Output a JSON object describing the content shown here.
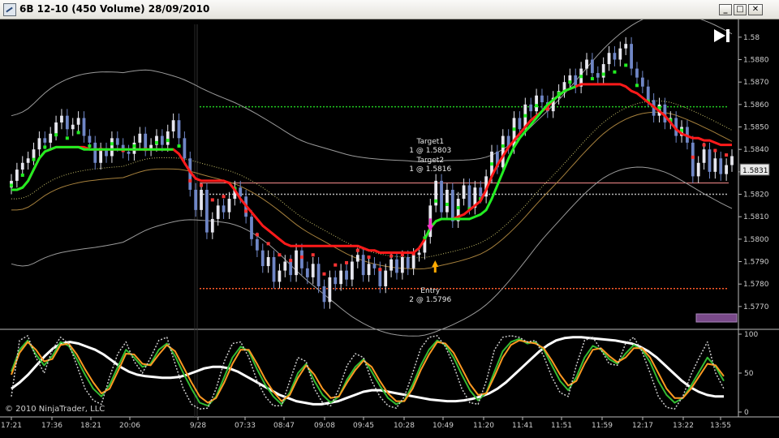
{
  "window": {
    "title": "6B 12-10 (450 Volume)  28/09/2010",
    "minimize_label": "_",
    "maximize_label": "□",
    "close_label": "✕"
  },
  "copyright": "© 2010 NinjaTrader, LLC",
  "colors": {
    "background": "#000000",
    "up_bar": "#e6e6ee",
    "down_bar": "#6f86c6",
    "slow_ma": "#ff1a1a",
    "fast_ma": "#22ee22",
    "dots_up": "#22ee22",
    "dots_down": "#ff3333",
    "target_line": "#20cc20",
    "stop_line": "#ff5a2a",
    "entry_line": "#ff9090",
    "osc_white": "#ffffff",
    "osc_green": "#33bb33",
    "osc_orange": "#ff9922",
    "osc_dotted": "#cccccc"
  },
  "chart_data": [
    {
      "type": "candlestick",
      "ylim": [
        1.5762,
        1.5895
      ],
      "y_ticks": [
        "1.5770",
        "1.5780",
        "1.5790",
        "1.5800",
        "1.5810",
        "1.5820",
        "1.5830",
        "1.5840",
        "1.5850",
        "1.5860",
        "1.5870",
        "1.5880",
        "1.58"
      ],
      "last_price": "1.5831",
      "x_labels": [
        "17:21",
        "17:36",
        "18:21",
        "20:06",
        "9/28",
        "07:33",
        "08:47",
        "09:08",
        "09:45",
        "10:28",
        "10:49",
        "11:20",
        "11:41",
        "11:51",
        "11:59",
        "12:17",
        "13:22",
        "13:55"
      ],
      "levels": {
        "target": 1.5859,
        "target_line2": 1.582,
        "entry": 1.5825,
        "stop": 1.5778
      },
      "annotations": [
        {
          "lines": [
            "Target1",
            "1 @ 1.5803"
          ]
        },
        {
          "lines": [
            "Target2",
            "1 @ 1.5816"
          ]
        },
        {
          "lines": [
            "Entry",
            "2 @ 1.5796"
          ]
        }
      ],
      "close": [
        1.5826,
        1.5831,
        1.5834,
        1.5836,
        1.584,
        1.5845,
        1.5843,
        1.5847,
        1.5852,
        1.5855,
        1.5849,
        1.5851,
        1.5854,
        1.5846,
        1.5843,
        1.5834,
        1.584,
        1.5837,
        1.5845,
        1.5842,
        1.5839,
        1.5838,
        1.5843,
        1.5847,
        1.584,
        1.5842,
        1.5846,
        1.5842,
        1.5848,
        1.5853,
        1.5845,
        1.5836,
        1.5822,
        1.5813,
        1.5822,
        1.5803,
        1.5809,
        1.5815,
        1.5812,
        1.5818,
        1.5823,
        1.5819,
        1.581,
        1.58,
        1.5795,
        1.5788,
        1.5792,
        1.5781,
        1.5786,
        1.579,
        1.5784,
        1.5795,
        1.5787,
        1.5783,
        1.5789,
        1.5779,
        1.5772,
        1.5783,
        1.578,
        1.5786,
        1.5782,
        1.579,
        1.5793,
        1.5784,
        1.5789,
        1.5787,
        1.5779,
        1.5786,
        1.5791,
        1.5785,
        1.5792,
        1.5787,
        1.5793,
        1.5794,
        1.5801,
        1.5815,
        1.5826,
        1.5812,
        1.5822,
        1.5808,
        1.5818,
        1.5824,
        1.5814,
        1.5823,
        1.5819,
        1.5828,
        1.5839,
        1.5832,
        1.5846,
        1.5841,
        1.5854,
        1.5849,
        1.586,
        1.5857,
        1.5864,
        1.5861,
        1.5857,
        1.5863,
        1.5866,
        1.587,
        1.5873,
        1.5868,
        1.5876,
        1.588,
        1.5874,
        1.5872,
        1.5878,
        1.5883,
        1.588,
        1.5885,
        1.5887,
        1.5876,
        1.5872,
        1.5868,
        1.5862,
        1.5855,
        1.586,
        1.5852,
        1.5854,
        1.5846,
        1.585,
        1.5843,
        1.5828,
        1.5834,
        1.584,
        1.583,
        1.5836,
        1.5829,
        1.5833,
        1.5837
      ],
      "slow_ma": [
        1.5822,
        1.5822,
        1.5823,
        1.5826,
        1.5831,
        1.5836,
        1.5839,
        1.584,
        1.5841,
        1.5841,
        1.5841,
        1.5841,
        1.5841,
        1.5841,
        1.584,
        1.584,
        1.584,
        1.584,
        1.584,
        1.584,
        1.584,
        1.584,
        1.584,
        1.584,
        1.584,
        1.584,
        1.584,
        1.584,
        1.584,
        1.584,
        1.5838,
        1.5834,
        1.583,
        1.5827,
        1.5826,
        1.5826,
        1.5826,
        1.5826,
        1.5826,
        1.5825,
        1.5822,
        1.5818,
        1.5815,
        1.5812,
        1.5809,
        1.5806,
        1.5804,
        1.5802,
        1.58,
        1.5798,
        1.5797,
        1.5797,
        1.5797,
        1.5797,
        1.5797,
        1.5797,
        1.5797,
        1.5797,
        1.5797,
        1.5797,
        1.5797,
        1.5797,
        1.5797,
        1.5796,
        1.5795,
        1.5795,
        1.5794,
        1.5794,
        1.5794,
        1.5794,
        1.5794,
        1.5794,
        1.5794,
        1.5796,
        1.58,
        1.5805,
        1.5808,
        1.5809,
        1.5809,
        1.5809,
        1.581,
        1.5811,
        1.5813,
        1.5815,
        1.5817,
        1.5822,
        1.5828,
        1.5833,
        1.5837,
        1.5841,
        1.5844,
        1.5847,
        1.585,
        1.5853,
        1.5855,
        1.5857,
        1.5859,
        1.5862,
        1.5864,
        1.5866,
        1.5867,
        1.5868,
        1.5869,
        1.5869,
        1.5869,
        1.5869,
        1.5869,
        1.5869,
        1.5869,
        1.5869,
        1.5868,
        1.5866,
        1.5865,
        1.5863,
        1.5861,
        1.5859,
        1.5857,
        1.5855,
        1.5852,
        1.5849,
        1.5847,
        1.5846,
        1.5845,
        1.5845,
        1.5844,
        1.5844,
        1.5843,
        1.5842,
        1.5842,
        1.5842
      ],
      "fast_ma": [
        1.5822,
        1.5822,
        1.5823,
        1.5826,
        1.5831,
        1.5836,
        1.5839,
        1.584,
        1.5841,
        1.5841,
        1.5841,
        1.5841,
        1.5841,
        1.584,
        1.584,
        1.584,
        1.584,
        1.584,
        1.584,
        1.584,
        1.584,
        1.584,
        1.584,
        1.584,
        1.584,
        1.584,
        1.584,
        1.584,
        1.584,
        1.584,
        1.5838,
        1.5834,
        1.583,
        1.5827,
        1.5826,
        1.5826,
        1.5826,
        1.5826,
        1.5826,
        1.5825,
        1.5822,
        1.5818,
        1.5815,
        1.5812,
        1.5809,
        1.5806,
        1.5804,
        1.5802,
        1.58,
        1.5798,
        1.5797,
        1.5797,
        1.5797,
        1.5797,
        1.5797,
        1.5797,
        1.5797,
        1.5797,
        1.5797,
        1.5797,
        1.5797,
        1.5797,
        1.5797,
        1.5796,
        1.5795,
        1.5795,
        1.5794,
        1.5794,
        1.5794,
        1.5794,
        1.5794,
        1.5794,
        1.5794,
        1.5796,
        1.58,
        1.5805,
        1.5808,
        1.5809,
        1.5809,
        1.5809,
        1.5809,
        1.5809,
        1.5809,
        1.581,
        1.5811,
        1.5813,
        1.5818,
        1.5824,
        1.583,
        1.5836,
        1.5841,
        1.5845,
        1.5848,
        1.5851,
        1.5854,
        1.5857,
        1.586,
        1.5862,
        1.5864,
        1.5866,
        1.5867,
        1.5868,
        1.5869,
        1.5869,
        1.5869,
        1.5869,
        1.5869,
        1.5869,
        1.5869,
        1.5869,
        1.5868,
        1.5866,
        1.5865,
        1.5863,
        1.5861,
        1.5859,
        1.5857,
        1.5855,
        1.5852,
        1.5849,
        1.5847,
        1.5846,
        1.5845,
        1.5845,
        1.5844,
        1.5844,
        1.5843,
        1.5842,
        1.5842,
        1.5842
      ]
    },
    {
      "type": "line",
      "ylim": [
        0,
        100
      ],
      "y_ticks": [
        "100",
        "50",
        "0"
      ],
      "series": [
        {
          "values": [
            30,
            38,
            48,
            60,
            72,
            82,
            88,
            90,
            88,
            84,
            80,
            74,
            66,
            58,
            52,
            48,
            46,
            45,
            44,
            44,
            45,
            48,
            52,
            56,
            58,
            58,
            56,
            52,
            46,
            40,
            34,
            28,
            22,
            18,
            14,
            12,
            10,
            10,
            12,
            14,
            18,
            22,
            26,
            28,
            28,
            26,
            24,
            22,
            20,
            18,
            16,
            15,
            14,
            14,
            15,
            17,
            20,
            24,
            30,
            38,
            48,
            58,
            68,
            78,
            86,
            92,
            95,
            96,
            96,
            95,
            94,
            93,
            92,
            90,
            88,
            84,
            78,
            70,
            60,
            50,
            40,
            32,
            26,
            22,
            20,
            20
          ]
        },
        {
          "values": [
            52,
            80,
            92,
            74,
            60,
            72,
            90,
            85,
            68,
            48,
            30,
            20,
            35,
            58,
            80,
            70,
            58,
            62,
            80,
            88,
            72,
            50,
            30,
            12,
            8,
            20,
            45,
            70,
            84,
            78,
            55,
            35,
            20,
            10,
            25,
            50,
            62,
            40,
            22,
            12,
            20,
            42,
            58,
            68,
            52,
            34,
            18,
            10,
            15,
            35,
            60,
            80,
            92,
            86,
            70,
            48,
            28,
            15,
            25,
            52,
            78,
            90,
            94,
            88,
            90,
            80,
            60,
            40,
            28,
            45,
            70,
            85,
            80,
            68,
            62,
            75,
            86,
            80,
            64,
            40,
            22,
            12,
            18,
            34,
            52,
            70,
            58,
            40
          ]
        },
        {
          "values": [
            48,
            76,
            90,
            80,
            65,
            68,
            86,
            88,
            74,
            55,
            38,
            24,
            30,
            52,
            75,
            74,
            62,
            60,
            74,
            86,
            78,
            58,
            38,
            20,
            12,
            18,
            38,
            62,
            80,
            80,
            62,
            42,
            26,
            14,
            22,
            44,
            60,
            48,
            30,
            18,
            20,
            38,
            54,
            66,
            58,
            40,
            24,
            14,
            14,
            30,
            54,
            74,
            90,
            88,
            76,
            56,
            36,
            22,
            24,
            46,
            70,
            86,
            92,
            90,
            88,
            82,
            66,
            48,
            34,
            40,
            62,
            80,
            82,
            72,
            64,
            70,
            82,
            82,
            70,
            50,
            30,
            18,
            18,
            30,
            46,
            62,
            60,
            46
          ]
        },
        {
          "values": [
            20,
            92,
            98,
            70,
            50,
            80,
            96,
            88,
            60,
            30,
            15,
            10,
            45,
            75,
            90,
            65,
            50,
            70,
            92,
            96,
            62,
            30,
            10,
            4,
            5,
            30,
            65,
            88,
            90,
            70,
            40,
            20,
            8,
            8,
            40,
            70,
            65,
            30,
            12,
            8,
            30,
            60,
            75,
            70,
            40,
            20,
            8,
            5,
            20,
            50,
            82,
            96,
            98,
            84,
            60,
            30,
            12,
            10,
            40,
            80,
            96,
            98,
            96,
            90,
            92,
            72,
            45,
            25,
            20,
            60,
            92,
            96,
            80,
            62,
            60,
            88,
            96,
            78,
            50,
            20,
            6,
            4,
            20,
            48,
            70,
            90,
            50,
            30
          ]
        }
      ]
    }
  ]
}
